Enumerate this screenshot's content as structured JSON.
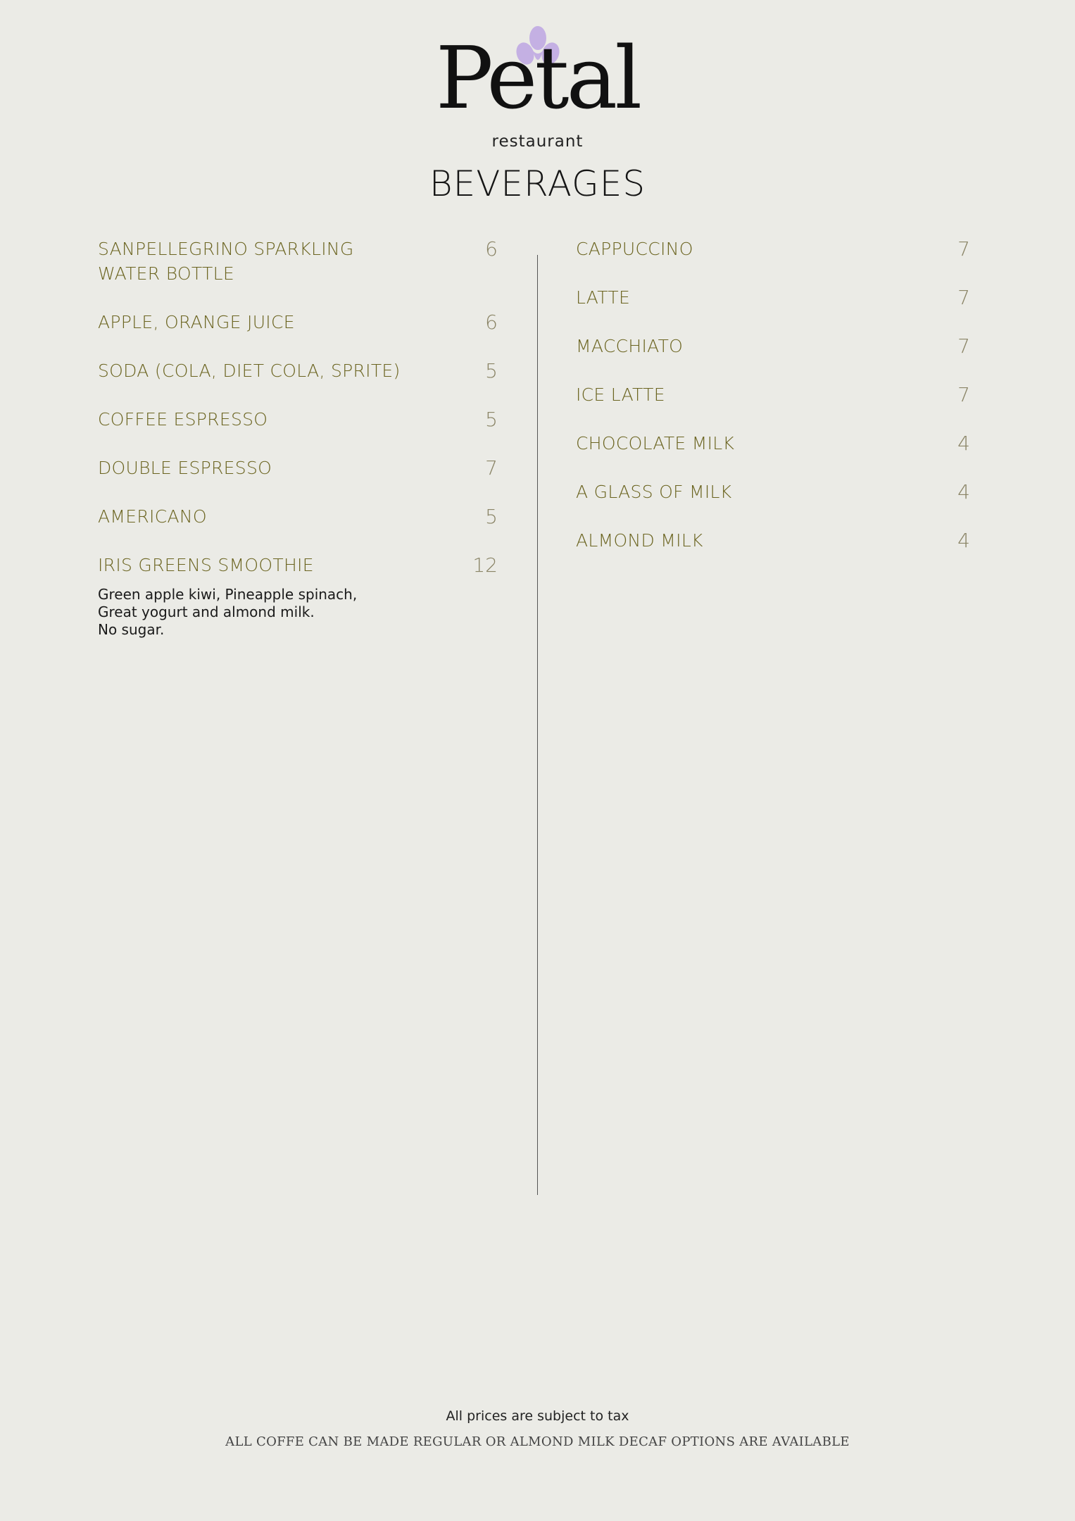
{
  "header": {
    "logo_text": "Petal",
    "logo_subtext": "restaurant",
    "logo_icon": "iris-flower-icon",
    "accent_color": "#c4b0e3"
  },
  "section_title": "BEVERAGES",
  "left_items": [
    {
      "name": "SANPELLEGRINO SPARKLING WATER BOTTLE",
      "price": "6"
    },
    {
      "name": "APPLE, ORANGE JUICE",
      "price": "6"
    },
    {
      "name": "SODA (COLA, DIET COLA, SPRITE)",
      "price": "5"
    },
    {
      "name": "COFFEE ESPRESSO",
      "price": "5"
    },
    {
      "name": "DOUBLE ESPRESSO",
      "price": "7"
    },
    {
      "name": "AMERICANO",
      "price": "5"
    },
    {
      "name": "IRIS GREENS SMOOTHIE",
      "price": "12"
    }
  ],
  "smoothie_description": {
    "line1": "Green apple kiwi, Pineapple spinach,",
    "line2": "Great yogurt and almond milk.",
    "line3": "No sugar."
  },
  "right_items": [
    {
      "name": "CAPPUCCINO",
      "price": "7"
    },
    {
      "name": "LATTE",
      "price": "7"
    },
    {
      "name": "MACCHIATO",
      "price": "7"
    },
    {
      "name": "ICE LATTE",
      "price": "7"
    },
    {
      "name": "CHOCOLATE MILK",
      "price": "4"
    },
    {
      "name": "A GLASS OF MILK",
      "price": "4"
    },
    {
      "name": "ALMOND MILK",
      "price": "4"
    }
  ],
  "footer": {
    "tax_note": "All prices are subject to tax",
    "coffee_note": "ALL COFFE CAN BE MADE REGULAR OR ALMOND MILK DECAF OPTIONS ARE AVAILABLE"
  }
}
